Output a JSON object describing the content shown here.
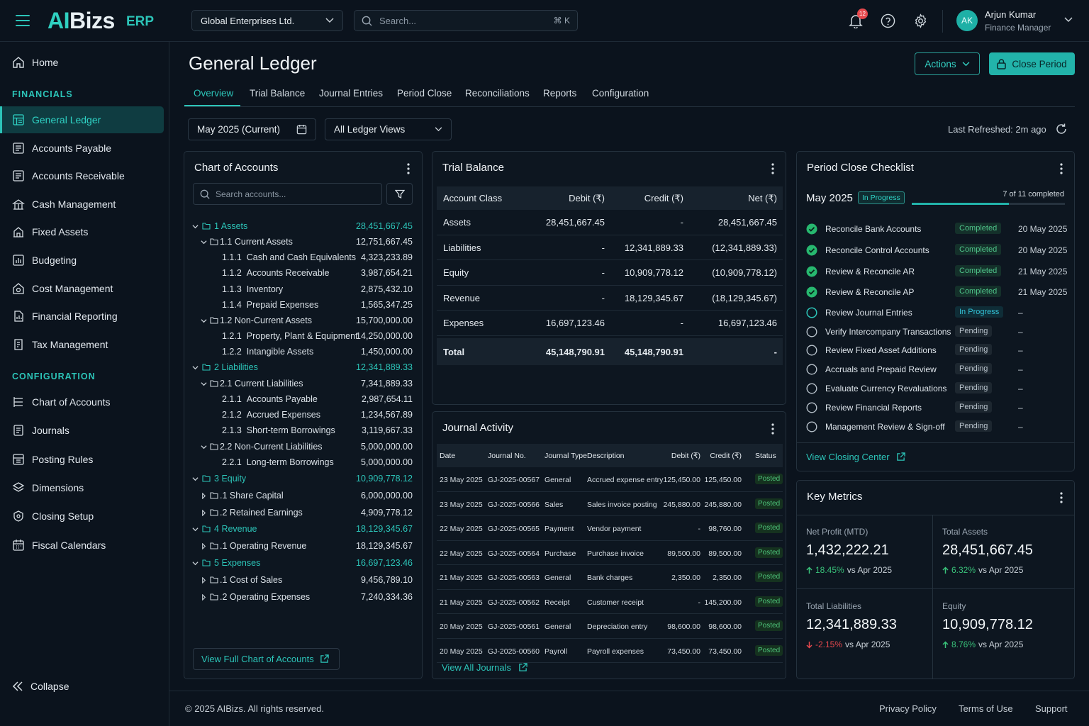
{
  "app": {
    "logo": "AIBizs",
    "logo_ai": "AI",
    "logo_rest": "Bizs",
    "logo_suffix": "ERP"
  },
  "topbar": {
    "company": "Global Enterprises Ltd.",
    "search_placeholder": "Search...",
    "search_shortcut": "⌘ K",
    "notifications_count": "12",
    "user": {
      "initials": "AK",
      "name": "Arjun Kumar",
      "role": "Finance Manager"
    }
  },
  "sidebar": {
    "home": "Home",
    "section_financials": "FINANCIALS",
    "financials": [
      "General Ledger",
      "Accounts Payable",
      "Accounts Receivable",
      "Cash Management",
      "Fixed Assets",
      "Budgeting",
      "Cost Management",
      "Financial Reporting",
      "Tax Management"
    ],
    "active": "General Ledger",
    "section_configuration": "CONFIGURATION",
    "configuration": [
      "Chart of Accounts",
      "Journals",
      "Posting Rules",
      "Dimensions",
      "Closing Setup",
      "Fiscal Calendars"
    ],
    "collapse": "Collapse"
  },
  "page": {
    "title": "General Ledger",
    "actions_label": "Actions",
    "close_period_label": "Close Period",
    "tabs": [
      "Overview",
      "Trial Balance",
      "Journal Entries",
      "Period Close",
      "Reconciliations",
      "Reports",
      "Configuration"
    ],
    "active_tab": "Overview",
    "period": "May 2025 (Current)",
    "ledger_view": "All Ledger Views",
    "last_refreshed_label": "Last Refreshed:",
    "last_refreshed_value": "2m ago"
  },
  "chart_of_accounts": {
    "title": "Chart of Accounts",
    "search_placeholder": "Search accounts...",
    "rows": [
      {
        "level": 0,
        "code": "1",
        "name": "Assets",
        "amount": "28,451,667.45",
        "expand": "open"
      },
      {
        "level": 1,
        "code": "1.1",
        "name": "Current Assets",
        "amount": "12,751,667.45",
        "expand": "open"
      },
      {
        "level": 2,
        "code": "1.1.1",
        "name": "Cash and Cash Equivalents",
        "amount": "4,323,233.89"
      },
      {
        "level": 2,
        "code": "1.1.2",
        "name": "Accounts Receivable",
        "amount": "3,987,654.21"
      },
      {
        "level": 2,
        "code": "1.1.3",
        "name": "Inventory",
        "amount": "2,875,432.10"
      },
      {
        "level": 2,
        "code": "1.1.4",
        "name": "Prepaid Expenses",
        "amount": "1,565,347.25"
      },
      {
        "level": 1,
        "code": "1.2",
        "name": "Non-Current Assets",
        "amount": "15,700,000.00",
        "expand": "open"
      },
      {
        "level": 2,
        "code": "1.2.1",
        "name": "Property, Plant & Equipment",
        "amount": "14,250,000.00"
      },
      {
        "level": 2,
        "code": "1.2.2",
        "name": "Intangible Assets",
        "amount": "1,450,000.00"
      },
      {
        "level": 0,
        "code": "2",
        "name": "Liabilities",
        "amount": "12,341,889.33",
        "expand": "open"
      },
      {
        "level": 1,
        "code": "2.1",
        "name": "Current Liabilities",
        "amount": "7,341,889.33",
        "expand": "open"
      },
      {
        "level": 2,
        "code": "2.1.1",
        "name": "Accounts Payable",
        "amount": "2,987,654.11"
      },
      {
        "level": 2,
        "code": "2.1.2",
        "name": "Accrued Expenses",
        "amount": "1,234,567.89"
      },
      {
        "level": 2,
        "code": "2.1.3",
        "name": "Short-term Borrowings",
        "amount": "3,119,667.33"
      },
      {
        "level": 1,
        "code": "2.2",
        "name": "Non-Current Liabilities",
        "amount": "5,000,000.00",
        "expand": "open"
      },
      {
        "level": 2,
        "code": "2.2.1",
        "name": "Long-term Borrowings",
        "amount": "5,000,000.00"
      },
      {
        "level": 0,
        "code": "3",
        "name": "Equity",
        "amount": "10,909,778.12",
        "expand": "open"
      },
      {
        "level": 1,
        "code": ".1",
        "name": "Share Capital",
        "amount": "6,000,000.00",
        "expand": "closed"
      },
      {
        "level": 1,
        "code": ".2",
        "name": "Retained Earnings",
        "amount": "4,909,778.12",
        "expand": "closed"
      },
      {
        "level": 0,
        "code": "4",
        "name": "Revenue",
        "amount": "18,129,345.67",
        "expand": "open"
      },
      {
        "level": 1,
        "code": ".1",
        "name": "Operating Revenue",
        "amount": "18,129,345.67",
        "expand": "closed"
      },
      {
        "level": 0,
        "code": "5",
        "name": "Expenses",
        "amount": "16,697,123.46",
        "expand": "open"
      },
      {
        "level": 1,
        "code": ".1",
        "name": "Cost of Sales",
        "amount": "9,456,789.10",
        "expand": "closed"
      },
      {
        "level": 1,
        "code": ".2",
        "name": "Operating Expenses",
        "amount": "7,240,334.36",
        "expand": "closed"
      }
    ],
    "view_full_label": "View Full Chart of Accounts"
  },
  "trial_balance": {
    "title": "Trial Balance",
    "headers": [
      "Account Class",
      "Debit (₹)",
      "Credit (₹)",
      "Net (₹)"
    ],
    "rows": [
      [
        "Assets",
        "28,451,667.45",
        "-",
        "28,451,667.45"
      ],
      [
        "Liabilities",
        "-",
        "12,341,889.33",
        "(12,341,889.33)"
      ],
      [
        "Equity",
        "-",
        "10,909,778.12",
        "(10,909,778.12)"
      ],
      [
        "Revenue",
        "-",
        "18,129,345.67",
        "(18,129,345.67)"
      ],
      [
        "Expenses",
        "16,697,123.46",
        "-",
        "16,697,123.46"
      ]
    ],
    "total": [
      "Total",
      "45,148,790.91",
      "45,148,790.91",
      "-"
    ]
  },
  "journal_activity": {
    "title": "Journal Activity",
    "headers": [
      "Date",
      "Journal No.",
      "Journal Type",
      "Description",
      "Debit (₹)",
      "Credit (₹)",
      "Status"
    ],
    "rows": [
      [
        "23 May 2025",
        "GJ-2025-00567",
        "General",
        "Accrued expense entry",
        "125,450.00",
        "125,450.00",
        "Posted"
      ],
      [
        "23 May 2025",
        "GJ-2025-00566",
        "Sales",
        "Sales invoice posting",
        "245,880.00",
        "245,880.00",
        "Posted"
      ],
      [
        "22 May 2025",
        "GJ-2025-00565",
        "Payment",
        "Vendor payment",
        "-",
        "98,760.00",
        "Posted"
      ],
      [
        "22 May 2025",
        "GJ-2025-00564",
        "Purchase",
        "Purchase invoice",
        "89,500.00",
        "89,500.00",
        "Posted"
      ],
      [
        "21 May 2025",
        "GJ-2025-00563",
        "General",
        "Bank charges",
        "2,350.00",
        "2,350.00",
        "Posted"
      ],
      [
        "21 May 2025",
        "GJ-2025-00562",
        "Receipt",
        "Customer receipt",
        "-",
        "145,200.00",
        "Posted"
      ],
      [
        "20 May 2025",
        "GJ-2025-00561",
        "General",
        "Depreciation entry",
        "98,600.00",
        "98,600.00",
        "Posted"
      ],
      [
        "20 May 2025",
        "GJ-2025-00560",
        "Payroll",
        "Payroll expenses",
        "73,450.00",
        "73,450.00",
        "Posted"
      ]
    ],
    "view_all_label": "View All Journals"
  },
  "period_close": {
    "title": "Period Close Checklist",
    "month": "May 2025",
    "status": "In Progress",
    "progress_text": "7 of 11 completed",
    "progress_fraction": 0.6364,
    "items": [
      {
        "task": "Reconcile Bank Accounts",
        "status": "Completed",
        "date": "20 May 2025",
        "state": "completed"
      },
      {
        "task": "Reconcile Control Accounts",
        "status": "Completed",
        "date": "20 May 2025",
        "state": "completed"
      },
      {
        "task": "Review & Reconcile AR",
        "status": "Completed",
        "date": "21 May 2025",
        "state": "completed"
      },
      {
        "task": "Review & Reconcile AP",
        "status": "Completed",
        "date": "21 May 2025",
        "state": "completed"
      },
      {
        "task": "Review Journal Entries",
        "status": "In Progress",
        "date": "–",
        "state": "inprogress"
      },
      {
        "task": "Verify Intercompany Transactions",
        "status": "Pending",
        "date": "–",
        "state": "pending"
      },
      {
        "task": "Review Fixed Asset Additions",
        "status": "Pending",
        "date": "–",
        "state": "pending"
      },
      {
        "task": "Accruals and Prepaid Review",
        "status": "Pending",
        "date": "–",
        "state": "pending"
      },
      {
        "task": "Evaluate Currency Revaluations",
        "status": "Pending",
        "date": "–",
        "state": "pending"
      },
      {
        "task": "Review Financial Reports",
        "status": "Pending",
        "date": "–",
        "state": "pending"
      },
      {
        "task": "Management Review & Sign-off",
        "status": "Pending",
        "date": "–",
        "state": "pending"
      }
    ],
    "view_link": "View Closing Center"
  },
  "key_metrics": {
    "title": "Key Metrics",
    "items": [
      {
        "label": "Net Profit (MTD)",
        "value": "1,432,222.21",
        "delta": "18.45%",
        "direction": "up",
        "compare": "vs Apr 2025"
      },
      {
        "label": "Total Assets",
        "value": "28,451,667.45",
        "delta": "6.32%",
        "direction": "up",
        "compare": "vs Apr 2025"
      },
      {
        "label": "Total Liabilities",
        "value": "12,341,889.33",
        "delta": "-2.15%",
        "direction": "down",
        "compare": "vs Apr 2025"
      },
      {
        "label": "Equity",
        "value": "10,909,778.12",
        "delta": "8.76%",
        "direction": "up",
        "compare": "vs Apr 2025"
      }
    ]
  },
  "footer": {
    "copyright": "© 2025 AIBizs. All rights reserved.",
    "links": [
      "Privacy Policy",
      "Terms of Use",
      "Support"
    ]
  },
  "colors": {
    "accent": "#2cc4b8",
    "background": "#0b131d",
    "panel": "#0d1620",
    "danger": "#e5484d",
    "success": "#39c27a"
  }
}
